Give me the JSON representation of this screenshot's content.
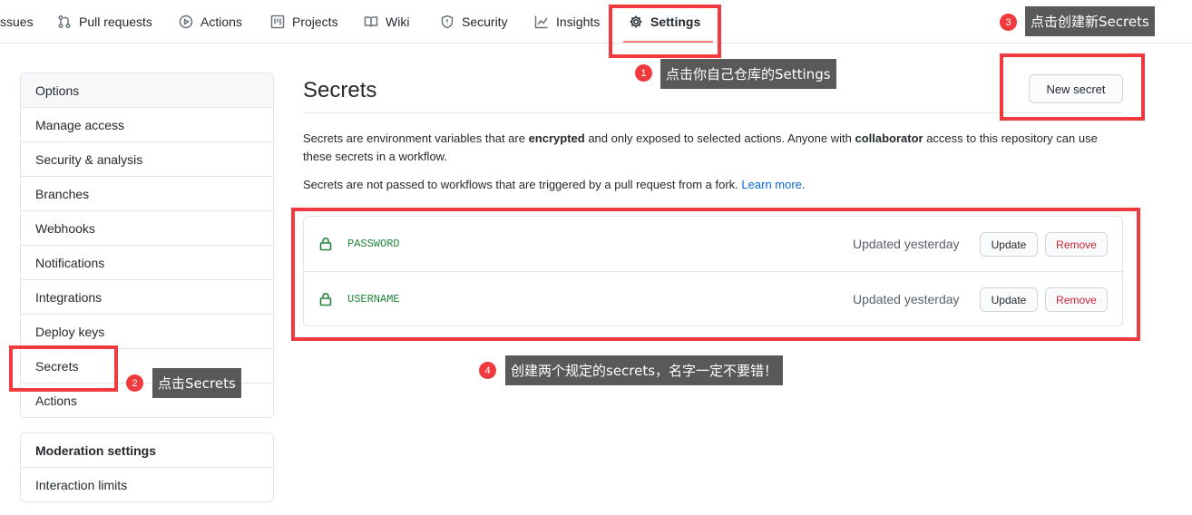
{
  "nav": {
    "tabs": [
      {
        "label": "ssues",
        "icon": "issue-opened-icon"
      },
      {
        "label": "Pull requests",
        "icon": "git-pull-request-icon"
      },
      {
        "label": "Actions",
        "icon": "play-icon"
      },
      {
        "label": "Projects",
        "icon": "project-icon"
      },
      {
        "label": "Wiki",
        "icon": "book-icon"
      },
      {
        "label": "Security",
        "icon": "shield-icon"
      },
      {
        "label": "Insights",
        "icon": "graph-icon"
      },
      {
        "label": "Settings",
        "icon": "gear-icon",
        "selected": true
      }
    ]
  },
  "sidebar": {
    "items": [
      "Options",
      "Manage access",
      "Security & analysis",
      "Branches",
      "Webhooks",
      "Notifications",
      "Integrations",
      "Deploy keys",
      "Secrets",
      "Actions"
    ],
    "moderation": {
      "heading": "Moderation settings",
      "items": [
        "Interaction limits"
      ]
    }
  },
  "main": {
    "title": "Secrets",
    "new_secret_button": "New secret",
    "desc1_part1": "Secrets are environment variables that are ",
    "desc1_bold1": "encrypted",
    "desc1_part2": " and only exposed to selected actions. Anyone with ",
    "desc1_bold2": "collaborator",
    "desc1_part3": " access to this repository can use these secrets in a workflow.",
    "desc2": "Secrets are not passed to workflows that are triggered by a pull request from a fork.",
    "learn_more": "Learn more",
    "desc2_end": ".",
    "secrets": [
      {
        "name": "PASSWORD",
        "updated": "Updated yesterday",
        "update_label": "Update",
        "remove_label": "Remove"
      },
      {
        "name": "USERNAME",
        "updated": "Updated yesterday",
        "update_label": "Update",
        "remove_label": "Remove"
      }
    ]
  },
  "annotations": [
    {
      "number": "1",
      "text": "点击你自己仓库的Settings"
    },
    {
      "number": "2",
      "text": "点击Secrets"
    },
    {
      "number": "3",
      "text": "点击创建新Secrets"
    },
    {
      "number": "4",
      "text": "创建两个规定的secrets，名字一定不要错！"
    }
  ],
  "colors": {
    "accent_underline": "#f9826c",
    "annotation_red": "#f03a3e",
    "link": "#0366d6",
    "secret_name": "#22863a",
    "remove": "#cb2431"
  }
}
